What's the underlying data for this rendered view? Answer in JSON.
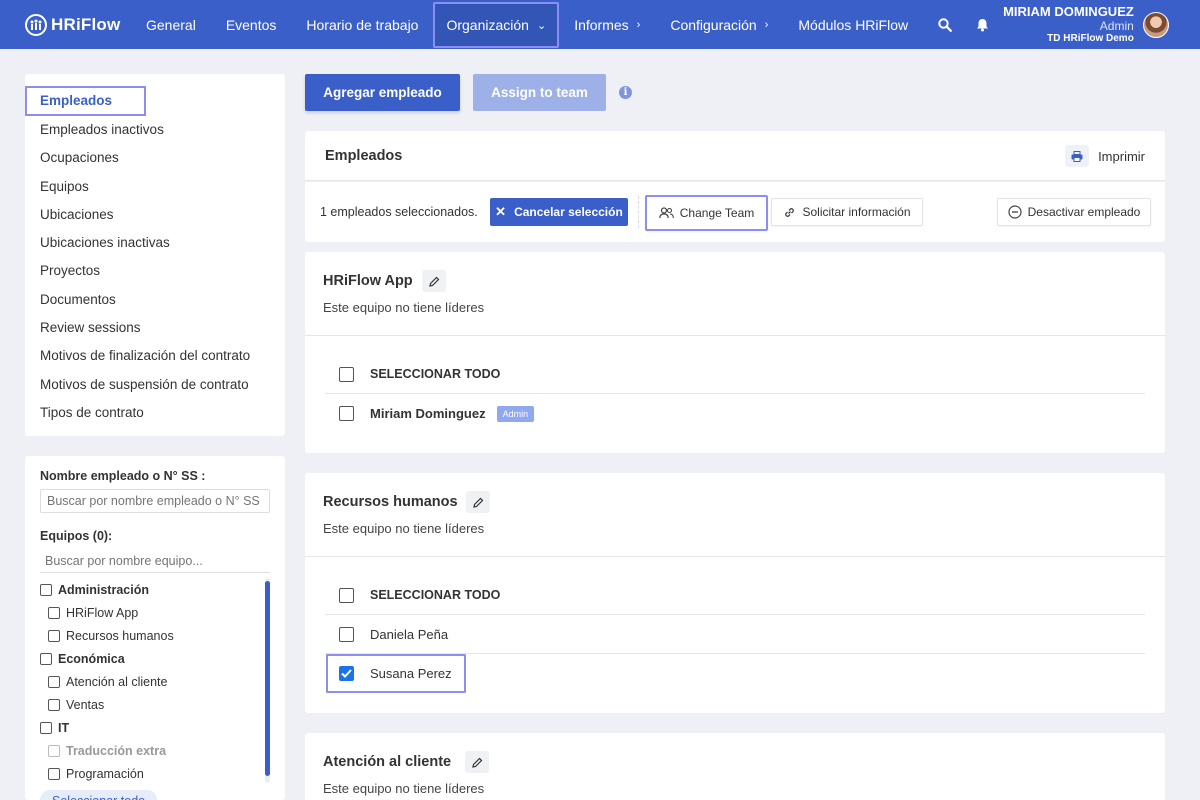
{
  "navbar": {
    "logo": "HRiFlow",
    "items": [
      {
        "label": "General",
        "chevron": ""
      },
      {
        "label": "Eventos",
        "chevron": ""
      },
      {
        "label": "Horario de trabajo",
        "chevron": ""
      },
      {
        "label": "Organización",
        "chevron": "⌄"
      },
      {
        "label": "Informes",
        "chevron": "›"
      },
      {
        "label": "Configuración",
        "chevron": "›"
      },
      {
        "label": "Módulos HRiFlow",
        "chevron": ""
      }
    ],
    "user": {
      "name": "MIRIAM DOMINGUEZ",
      "role": "Admin",
      "company": "TD HRiFlow Demo"
    }
  },
  "sidebar": {
    "items": [
      "Empleados",
      "Empleados inactivos",
      "Ocupaciones",
      "Equipos",
      "Ubicaciones",
      "Ubicaciones inactivas",
      "Proyectos",
      "Documentos",
      "Review sessions",
      "Motivos de finalización del contrato",
      "Motivos de suspensión de contrato",
      "Tipos de contrato"
    ]
  },
  "filters": {
    "name_label": "Nombre empleado o N° SS :",
    "name_placeholder": "Buscar por nombre empleado o N° SS",
    "teams_label": "Equipos (0):",
    "teams_placeholder": "Buscar por nombre equipo...",
    "teams": [
      {
        "label": "Administración",
        "level": "parent"
      },
      {
        "label": "HRiFlow App",
        "level": "sub"
      },
      {
        "label": "Recursos humanos",
        "level": "sub"
      },
      {
        "label": "Económica",
        "level": "parent"
      },
      {
        "label": "Atención al cliente",
        "level": "sub"
      },
      {
        "label": "Ventas",
        "level": "sub"
      },
      {
        "label": "IT",
        "level": "parent"
      },
      {
        "label": "Traducción extra",
        "level": "disabled"
      },
      {
        "label": "Programación",
        "level": "sub"
      }
    ],
    "select_all": "Seleccionar todo"
  },
  "toolbar": {
    "add_employee": "Agregar empleado",
    "assign_team": "Assign to team"
  },
  "employees": {
    "title": "Empleados",
    "print": "Imprimir",
    "selected_text": "1 empleados seleccionados.",
    "cancel_selection": "Cancelar selección",
    "change_team": "Change Team",
    "request_info": "Solicitar información",
    "deactivate": "Desactivar empleado"
  },
  "teams": [
    {
      "name": "HRiFlow App",
      "leaders": "Este equipo no tiene líderes",
      "select_all": "SELECCIONAR TODO",
      "members": [
        {
          "name": "Miriam Dominguez",
          "badge": "Admin",
          "checked": false
        }
      ]
    },
    {
      "name": "Recursos humanos",
      "leaders": "Este equipo no tiene líderes",
      "select_all": "SELECCIONAR TODO",
      "members": [
        {
          "name": "Daniela Peña",
          "badge": "",
          "checked": false
        },
        {
          "name": "Susana Perez",
          "badge": "",
          "checked": true
        }
      ]
    },
    {
      "name": "Atención al cliente",
      "leaders": "Este equipo no tiene líderes"
    }
  ]
}
